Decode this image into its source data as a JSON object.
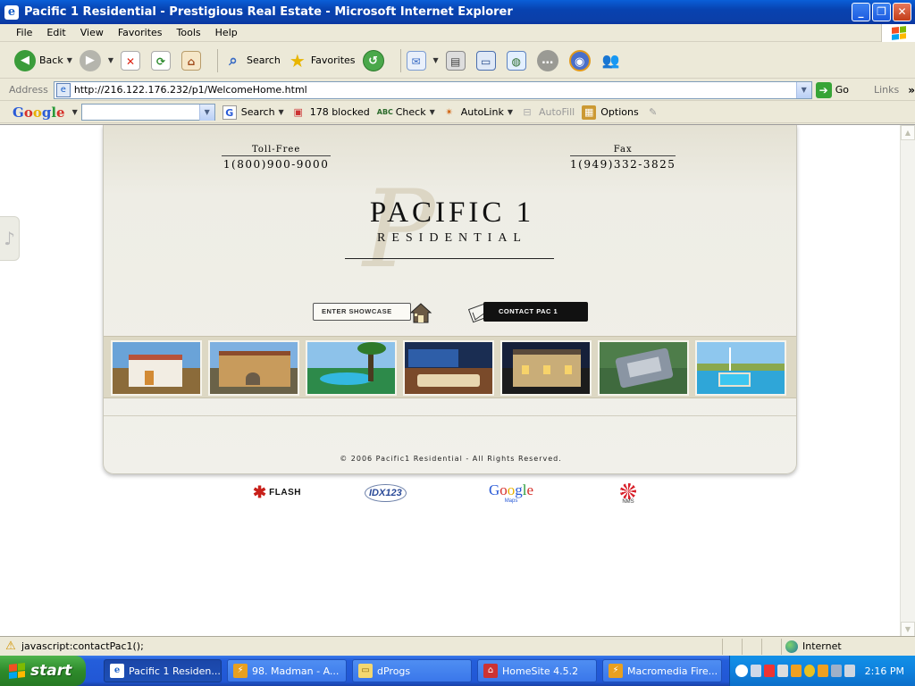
{
  "window": {
    "title": "Pacific 1 Residential - Prestigious Real Estate - Microsoft Internet Explorer"
  },
  "menu": [
    "File",
    "Edit",
    "View",
    "Favorites",
    "Tools",
    "Help"
  ],
  "toolbar": {
    "back_label": "Back",
    "search_label": "Search",
    "favorites_label": "Favorites"
  },
  "address": {
    "label": "Address",
    "url": "http://216.122.176.232/p1/WelcomeHome.html",
    "go_label": "Go",
    "links_label": "Links",
    "more_label": "»"
  },
  "googlebar": {
    "logo": "Google",
    "search_label": "Search",
    "blocked_label": "178 blocked",
    "check_label": "Check",
    "autolink_label": "AutoLink",
    "autofill_label": "AutoFill",
    "options_label": "Options"
  },
  "site": {
    "tollfree_label": "Toll-Free",
    "tollfree_number": "1(800)900-9000",
    "fax_label": "Fax",
    "fax_number": "1(949)332-3825",
    "brand_line1": "PACIFIC 1",
    "brand_line2": "RESIDENTIAL",
    "showcase_button": "ENTER SHOWCASE",
    "contact_button": "CONTACT PAC 1",
    "copyright": "© 2006 Pacific1 Residential  -  All Rights Reserved."
  },
  "partners": {
    "flash": "FLASH",
    "idx": "IDX123",
    "google": "Google",
    "google_sub": "Maps",
    "nms": "NMS"
  },
  "status": {
    "text": "javascript:contactPac1();",
    "zone": "Internet"
  },
  "taskbar": {
    "start_label": "start",
    "tasks": [
      "Pacific 1 Residen...",
      "98. Madman - A...",
      "dProgs",
      "HomeSite 4.5.2",
      "Macromedia Fire..."
    ],
    "clock": "2:16 PM"
  }
}
